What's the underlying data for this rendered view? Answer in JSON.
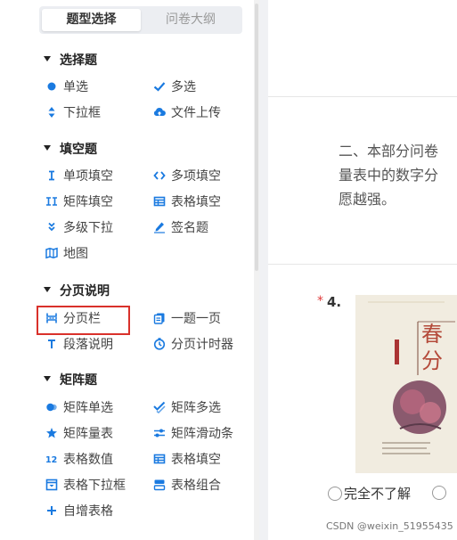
{
  "tabs": {
    "active": "题型选择",
    "inactive": "问卷大纲"
  },
  "groups": [
    {
      "title": "选择题",
      "items": [
        {
          "label": "单选",
          "icon": "dot-icon"
        },
        {
          "label": "多选",
          "icon": "check-icon"
        },
        {
          "label": "下拉框",
          "icon": "updown-icon"
        },
        {
          "label": "文件上传",
          "icon": "cloud-upload-icon"
        }
      ]
    },
    {
      "title": "填空题",
      "items": [
        {
          "label": "单项填空",
          "icon": "text-cursor-icon"
        },
        {
          "label": "多项填空",
          "icon": "code-brackets-icon"
        },
        {
          "label": "矩阵填空",
          "icon": "double-cursor-icon"
        },
        {
          "label": "表格填空",
          "icon": "table-icon"
        },
        {
          "label": "多级下拉",
          "icon": "double-chevron-down-icon"
        },
        {
          "label": "签名题",
          "icon": "pen-icon"
        },
        {
          "label": "地图",
          "icon": "map-icon"
        }
      ]
    },
    {
      "title": "分页说明",
      "items": [
        {
          "label": "分页栏",
          "icon": "page-break-icon"
        },
        {
          "label": "一题一页",
          "icon": "pages-icon"
        },
        {
          "label": "段落说明",
          "icon": "paragraph-t-icon"
        },
        {
          "label": "分页计时器",
          "icon": "timer-icon"
        }
      ]
    },
    {
      "title": "矩阵题",
      "items": [
        {
          "label": "矩阵单选",
          "icon": "matrix-radio-icon"
        },
        {
          "label": "矩阵多选",
          "icon": "matrix-check-icon"
        },
        {
          "label": "矩阵量表",
          "icon": "star-icon"
        },
        {
          "label": "矩阵滑动条",
          "icon": "sliders-icon"
        },
        {
          "label": "表格数值",
          "icon": "number-12-icon"
        },
        {
          "label": "表格填空",
          "icon": "table-icon"
        },
        {
          "label": "表格下拉框",
          "icon": "dropdown-box-icon"
        },
        {
          "label": "表格组合",
          "icon": "combo-icon"
        },
        {
          "label": "自增表格",
          "icon": "plus-icon"
        }
      ]
    }
  ],
  "main": {
    "line1": "二、本部分问卷",
    "line2": "量表中的数字分",
    "line3": "愿越强。",
    "question_star": "*",
    "question_number": "4.",
    "poster_chars": [
      "春",
      "分"
    ],
    "answer_option": "完全不了解"
  },
  "watermark": "CSDN @weixin_51955435",
  "colors": {
    "accent": "#1a7ae0",
    "highlight": "#d9312b",
    "star": "#e03b3b"
  }
}
